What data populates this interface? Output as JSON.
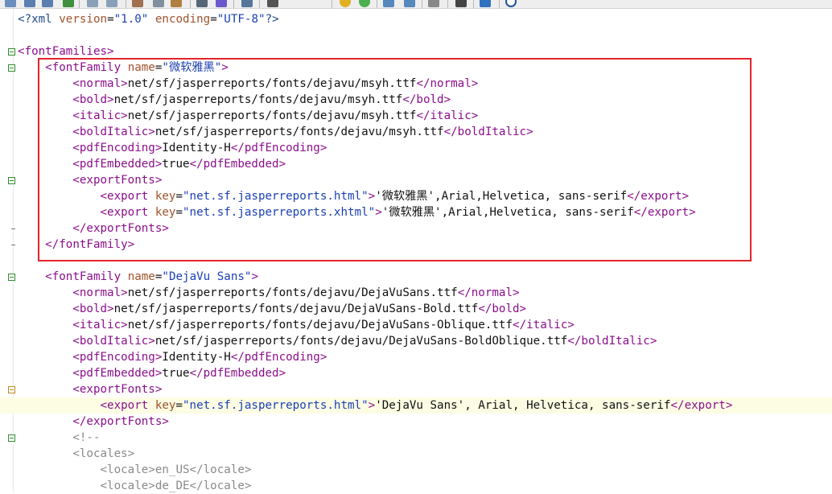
{
  "colors": {
    "tag": "#8b0f8b",
    "attribute": "#a0522d",
    "attribute_value": "#1a3fb3",
    "text": "#111111",
    "processing_instruction": "#204a87",
    "comment": "#8a8a8a",
    "highlight_line": "#fdfde4",
    "annotation_box": "#e3242b",
    "fold_marker": "#2c8c2c"
  },
  "toolbar": {
    "icons": [
      "new-file-icon",
      "save-icon",
      "save-all-icon",
      "revert-icon",
      "undo-icon",
      "redo-icon",
      "cut-icon",
      "copy-icon",
      "paste-icon",
      "find-icon",
      "replace-icon",
      "go-to-icon",
      "print-icon",
      "bookmark-icon",
      "add-bookmark-icon",
      "zoom-in-icon",
      "zoom-out-icon",
      "format-icon",
      "macro-icon",
      "pin-icon",
      "close-icon"
    ]
  },
  "lines": [
    {
      "indent": "",
      "tokens": [
        {
          "t": "<?xml",
          "c": "pi"
        },
        {
          "t": " ",
          "c": "text"
        },
        {
          "t": "version",
          "c": "attr"
        },
        {
          "t": "=",
          "c": "text"
        },
        {
          "t": "\"1.0\"",
          "c": "val"
        },
        {
          "t": " ",
          "c": "text"
        },
        {
          "t": "encoding",
          "c": "attr"
        },
        {
          "t": "=",
          "c": "text"
        },
        {
          "t": "\"UTF-8\"",
          "c": "val"
        },
        {
          "t": "?>",
          "c": "pi"
        }
      ]
    },
    {
      "indent": "",
      "tokens": []
    },
    {
      "indent": "",
      "fold": "open",
      "tokens": [
        {
          "t": "<fontFamilies>",
          "c": "tag"
        }
      ]
    },
    {
      "indent": "    ",
      "fold": "open",
      "tokens": [
        {
          "t": "<fontFamily",
          "c": "tag"
        },
        {
          "t": " ",
          "c": "text"
        },
        {
          "t": "name",
          "c": "attr"
        },
        {
          "t": "=",
          "c": "text"
        },
        {
          "t": "\"微软雅黑\"",
          "c": "val"
        },
        {
          "t": ">",
          "c": "tag"
        }
      ]
    },
    {
      "indent": "        ",
      "tokens": [
        {
          "t": "<normal>",
          "c": "tag"
        },
        {
          "t": "net/sf/jasperreports/fonts/dejavu/msyh.ttf",
          "c": "text"
        },
        {
          "t": "</normal>",
          "c": "tag"
        }
      ]
    },
    {
      "indent": "        ",
      "tokens": [
        {
          "t": "<bold>",
          "c": "tag"
        },
        {
          "t": "net/sf/jasperreports/fonts/dejavu/msyh.ttf",
          "c": "text"
        },
        {
          "t": "</bold>",
          "c": "tag"
        }
      ]
    },
    {
      "indent": "        ",
      "tokens": [
        {
          "t": "<italic>",
          "c": "tag"
        },
        {
          "t": "net/sf/jasperreports/fonts/dejavu/msyh.ttf",
          "c": "text"
        },
        {
          "t": "</italic>",
          "c": "tag"
        }
      ]
    },
    {
      "indent": "        ",
      "tokens": [
        {
          "t": "<boldItalic>",
          "c": "tag"
        },
        {
          "t": "net/sf/jasperreports/fonts/dejavu/msyh.ttf",
          "c": "text"
        },
        {
          "t": "</boldItalic>",
          "c": "tag"
        }
      ]
    },
    {
      "indent": "        ",
      "tokens": [
        {
          "t": "<pdfEncoding>",
          "c": "tag"
        },
        {
          "t": "Identity-H",
          "c": "text"
        },
        {
          "t": "</pdfEncoding>",
          "c": "tag"
        }
      ]
    },
    {
      "indent": "        ",
      "tokens": [
        {
          "t": "<pdfEmbedded>",
          "c": "tag"
        },
        {
          "t": "true",
          "c": "text"
        },
        {
          "t": "</pdfEmbedded>",
          "c": "tag"
        }
      ]
    },
    {
      "indent": "        ",
      "fold": "open",
      "tokens": [
        {
          "t": "<exportFonts>",
          "c": "tag"
        }
      ]
    },
    {
      "indent": "            ",
      "tokens": [
        {
          "t": "<export",
          "c": "tag"
        },
        {
          "t": " ",
          "c": "text"
        },
        {
          "t": "key",
          "c": "attr"
        },
        {
          "t": "=",
          "c": "text"
        },
        {
          "t": "\"net.sf.jasperreports.html\"",
          "c": "val"
        },
        {
          "t": ">",
          "c": "tag"
        },
        {
          "t": "'微软雅黑',Arial,Helvetica, sans-serif",
          "c": "text"
        },
        {
          "t": "</export>",
          "c": "tag"
        }
      ]
    },
    {
      "indent": "            ",
      "tokens": [
        {
          "t": "<export",
          "c": "tag"
        },
        {
          "t": " ",
          "c": "text"
        },
        {
          "t": "key",
          "c": "attr"
        },
        {
          "t": "=",
          "c": "text"
        },
        {
          "t": "\"net.sf.jasperreports.xhtml\"",
          "c": "val"
        },
        {
          "t": ">",
          "c": "tag"
        },
        {
          "t": "'微软雅黑',Arial,Helvetica, sans-serif",
          "c": "text"
        },
        {
          "t": "</export>",
          "c": "tag"
        }
      ]
    },
    {
      "indent": "        ",
      "fold": "end",
      "tokens": [
        {
          "t": "</exportFonts>",
          "c": "tag"
        }
      ]
    },
    {
      "indent": "    ",
      "fold": "end",
      "tokens": [
        {
          "t": "</fontFamily>",
          "c": "tag"
        }
      ]
    },
    {
      "indent": "",
      "tokens": []
    },
    {
      "indent": "    ",
      "fold": "open",
      "tokens": [
        {
          "t": "<fontFamily",
          "c": "tag"
        },
        {
          "t": " ",
          "c": "text"
        },
        {
          "t": "name",
          "c": "attr"
        },
        {
          "t": "=",
          "c": "text"
        },
        {
          "t": "\"DejaVu Sans\"",
          "c": "val"
        },
        {
          "t": ">",
          "c": "tag"
        }
      ]
    },
    {
      "indent": "        ",
      "tokens": [
        {
          "t": "<normal>",
          "c": "tag"
        },
        {
          "t": "net/sf/jasperreports/fonts/dejavu/DejaVuSans.ttf",
          "c": "text"
        },
        {
          "t": "</normal>",
          "c": "tag"
        }
      ]
    },
    {
      "indent": "        ",
      "tokens": [
        {
          "t": "<bold>",
          "c": "tag"
        },
        {
          "t": "net/sf/jasperreports/fonts/dejavu/DejaVuSans-Bold.ttf",
          "c": "text"
        },
        {
          "t": "</bold>",
          "c": "tag"
        }
      ]
    },
    {
      "indent": "        ",
      "tokens": [
        {
          "t": "<italic>",
          "c": "tag"
        },
        {
          "t": "net/sf/jasperreports/fonts/dejavu/DejaVuSans-Oblique.ttf",
          "c": "text"
        },
        {
          "t": "</italic>",
          "c": "tag"
        }
      ]
    },
    {
      "indent": "        ",
      "tokens": [
        {
          "t": "<boldItalic>",
          "c": "tag"
        },
        {
          "t": "net/sf/jasperreports/fonts/dejavu/DejaVuSans-BoldOblique.ttf",
          "c": "text"
        },
        {
          "t": "</boldItalic>",
          "c": "tag"
        }
      ]
    },
    {
      "indent": "        ",
      "tokens": [
        {
          "t": "<pdfEncoding>",
          "c": "tag"
        },
        {
          "t": "Identity-H",
          "c": "text"
        },
        {
          "t": "</pdfEncoding>",
          "c": "tag"
        }
      ]
    },
    {
      "indent": "        ",
      "tokens": [
        {
          "t": "<pdfEmbedded>",
          "c": "tag"
        },
        {
          "t": "true",
          "c": "text"
        },
        {
          "t": "</pdfEmbedded>",
          "c": "tag"
        }
      ]
    },
    {
      "indent": "        ",
      "fold": "amber",
      "tokens": [
        {
          "t": "<exportFonts>",
          "c": "tag"
        }
      ]
    },
    {
      "indent": "            ",
      "highlight": true,
      "tokens": [
        {
          "t": "<export",
          "c": "tag"
        },
        {
          "t": " ",
          "c": "text"
        },
        {
          "t": "key",
          "c": "attr"
        },
        {
          "t": "=",
          "c": "text"
        },
        {
          "t": "\"net.sf.jasperreports.html\"",
          "c": "val"
        },
        {
          "t": ">",
          "c": "tag"
        },
        {
          "t": "'DejaVu Sans', Arial, Helvetica, sans-serif",
          "c": "text"
        },
        {
          "t": "</export>",
          "c": "tag"
        }
      ]
    },
    {
      "indent": "        ",
      "tokens": [
        {
          "t": "</exportFonts>",
          "c": "tag"
        }
      ]
    },
    {
      "indent": "        ",
      "fold": "open",
      "tokens": [
        {
          "t": "<!--",
          "c": "comment"
        }
      ]
    },
    {
      "indent": "        ",
      "tokens": [
        {
          "t": "<locales>",
          "c": "comment"
        }
      ]
    },
    {
      "indent": "            ",
      "tokens": [
        {
          "t": "<locale>en_US</locale>",
          "c": "comment"
        }
      ]
    },
    {
      "indent": "            ",
      "tokens": [
        {
          "t": "<locale>de_DE</locale>",
          "c": "comment"
        }
      ]
    }
  ]
}
